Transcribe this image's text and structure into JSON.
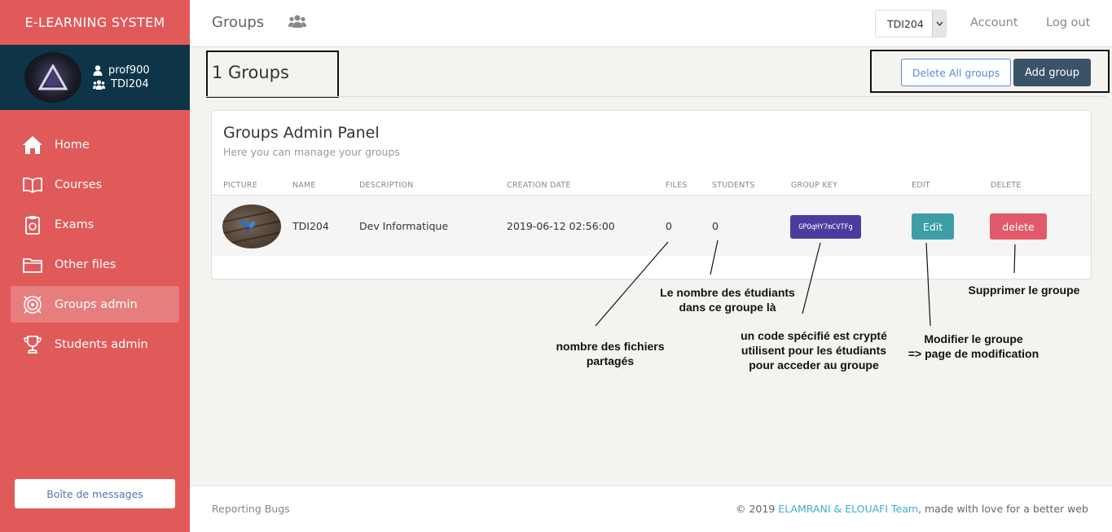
{
  "sidebar": {
    "brand": "E-LEARNING SYSTEM",
    "user": {
      "name": "prof900",
      "group": "TDI204"
    },
    "items": [
      {
        "label": "Home",
        "icon": "home-icon"
      },
      {
        "label": "Courses",
        "icon": "book-icon"
      },
      {
        "label": "Exams",
        "icon": "clipboard-icon"
      },
      {
        "label": "Other files",
        "icon": "folder-icon"
      },
      {
        "label": "Groups admin",
        "icon": "target-icon",
        "active": true
      },
      {
        "label": "Students admin",
        "icon": "trophy-icon"
      }
    ],
    "message_button": "Boîte de messages"
  },
  "topbar": {
    "title": "Groups",
    "selected_group": "TDI204",
    "account": "Account",
    "logout": "Log out"
  },
  "header": {
    "count_title": "1 Groups",
    "delete_all": "Delete All groups",
    "add_group": "Add group"
  },
  "panel": {
    "title": "Groups Admin Panel",
    "subtitle": "Here you can manage your groups",
    "columns": [
      "PICTURE",
      "NAME",
      "DESCRIPTION",
      "CREATION DATE",
      "FILES",
      "STUDENTS",
      "GROUP KEY",
      "EDIT",
      "DELETE"
    ],
    "rows": [
      {
        "name": "TDI204",
        "description": "Dev Informatique",
        "creation_date": "2019-06-12 02:56:00",
        "files": "0",
        "students": "0",
        "group_key": "GPOqHY7mCVTFg",
        "edit": "Edit",
        "delete": "delete"
      }
    ]
  },
  "annotations": {
    "files_line1": "nombre des fichiers",
    "files_line2": "partagés",
    "students_line1": "Le nombre des étudiants",
    "students_line2": "dans ce groupe là",
    "key_line1": "un code spécifié est crypté",
    "key_line2": "utilisent pour les étudiants",
    "key_line3": "pour acceder au groupe",
    "edit_line1": "Modifier le groupe",
    "edit_line2": "=> page de modification",
    "delete_line1": "Supprimer le groupe"
  },
  "footer": {
    "left": "Reporting Bugs",
    "copyright_prefix": "© 2019 ",
    "team": "ELAMRANI & ELOUAFI Team",
    "copyright_suffix": ", made with love for a better web"
  },
  "colors": {
    "sidebar": "#e05a5a",
    "user_box": "#0e3547",
    "accent_dark": "#3a5368",
    "key_badge": "#4b3ca0",
    "edit": "#3d9ea8",
    "delete": "#e05a6a"
  }
}
